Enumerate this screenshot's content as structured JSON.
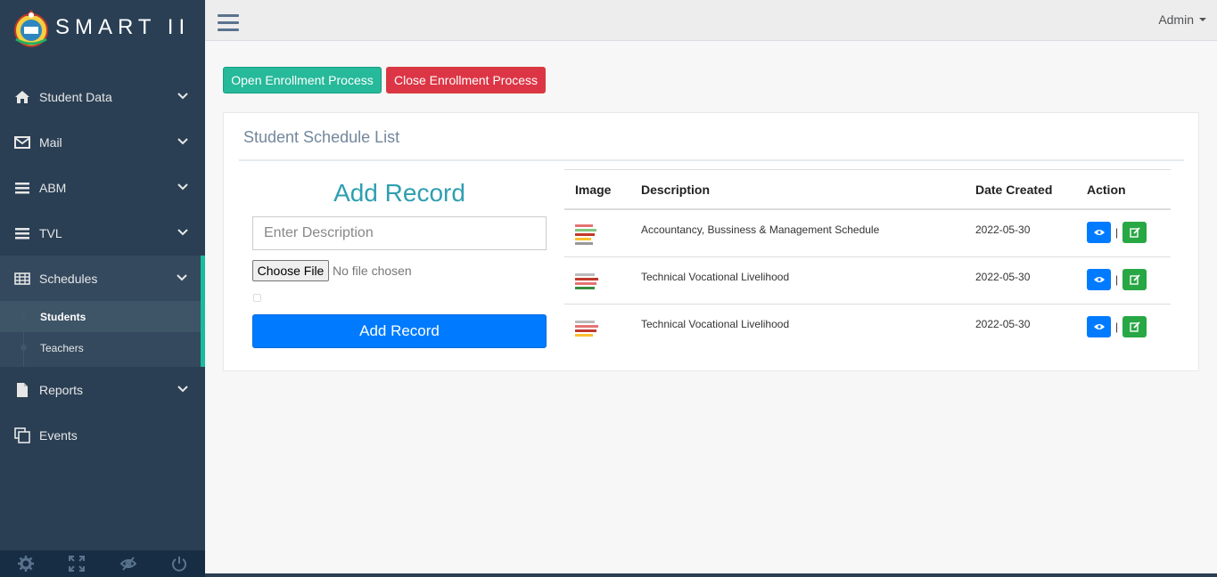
{
  "brand": {
    "title": "SMART II"
  },
  "sidebar": {
    "items": [
      {
        "label": "Student Data",
        "icon": "home-icon"
      },
      {
        "label": "Mail",
        "icon": "envelope-icon"
      },
      {
        "label": "ABM",
        "icon": "bars-icon"
      },
      {
        "label": "TVL",
        "icon": "bars-icon"
      },
      {
        "label": "Schedules",
        "icon": "table-icon"
      },
      {
        "label": "Reports",
        "icon": "file-icon"
      },
      {
        "label": "Events",
        "icon": "copy-icon"
      }
    ],
    "submenu": [
      {
        "label": "Students"
      },
      {
        "label": "Teachers"
      }
    ],
    "footer_icons": [
      "gear-icon",
      "fullscreen-icon",
      "eye-slash-icon",
      "power-icon"
    ]
  },
  "topnav": {
    "user": "Admin"
  },
  "actions": {
    "open_label": "Open Enrollment Process",
    "close_label": "Close Enrollment Process"
  },
  "panel": {
    "title": "Student Schedule List",
    "form": {
      "heading": "Add Record",
      "description_placeholder": "Enter Description",
      "file_button": "Choose File",
      "file_status": "No file chosen",
      "submit_label": "Add Record"
    },
    "table": {
      "headers": [
        "Image",
        "Description",
        "Date Created",
        "Action"
      ],
      "rows": [
        {
          "description": "Accountancy, Bussiness & Management Schedule",
          "date": "2022-05-30"
        },
        {
          "description": "Technical Vocational Livelihood",
          "date": "2022-05-30"
        },
        {
          "description": "Technical Vocational Livelihood",
          "date": "2022-05-30"
        }
      ]
    }
  },
  "colors": {
    "sidebar_bg": "#2a3f54",
    "accent_green": "#26b99a",
    "danger_red": "#dc3545",
    "primary_blue": "#007bff",
    "success_green": "#28a745",
    "title_teal": "#2e9fb1"
  }
}
